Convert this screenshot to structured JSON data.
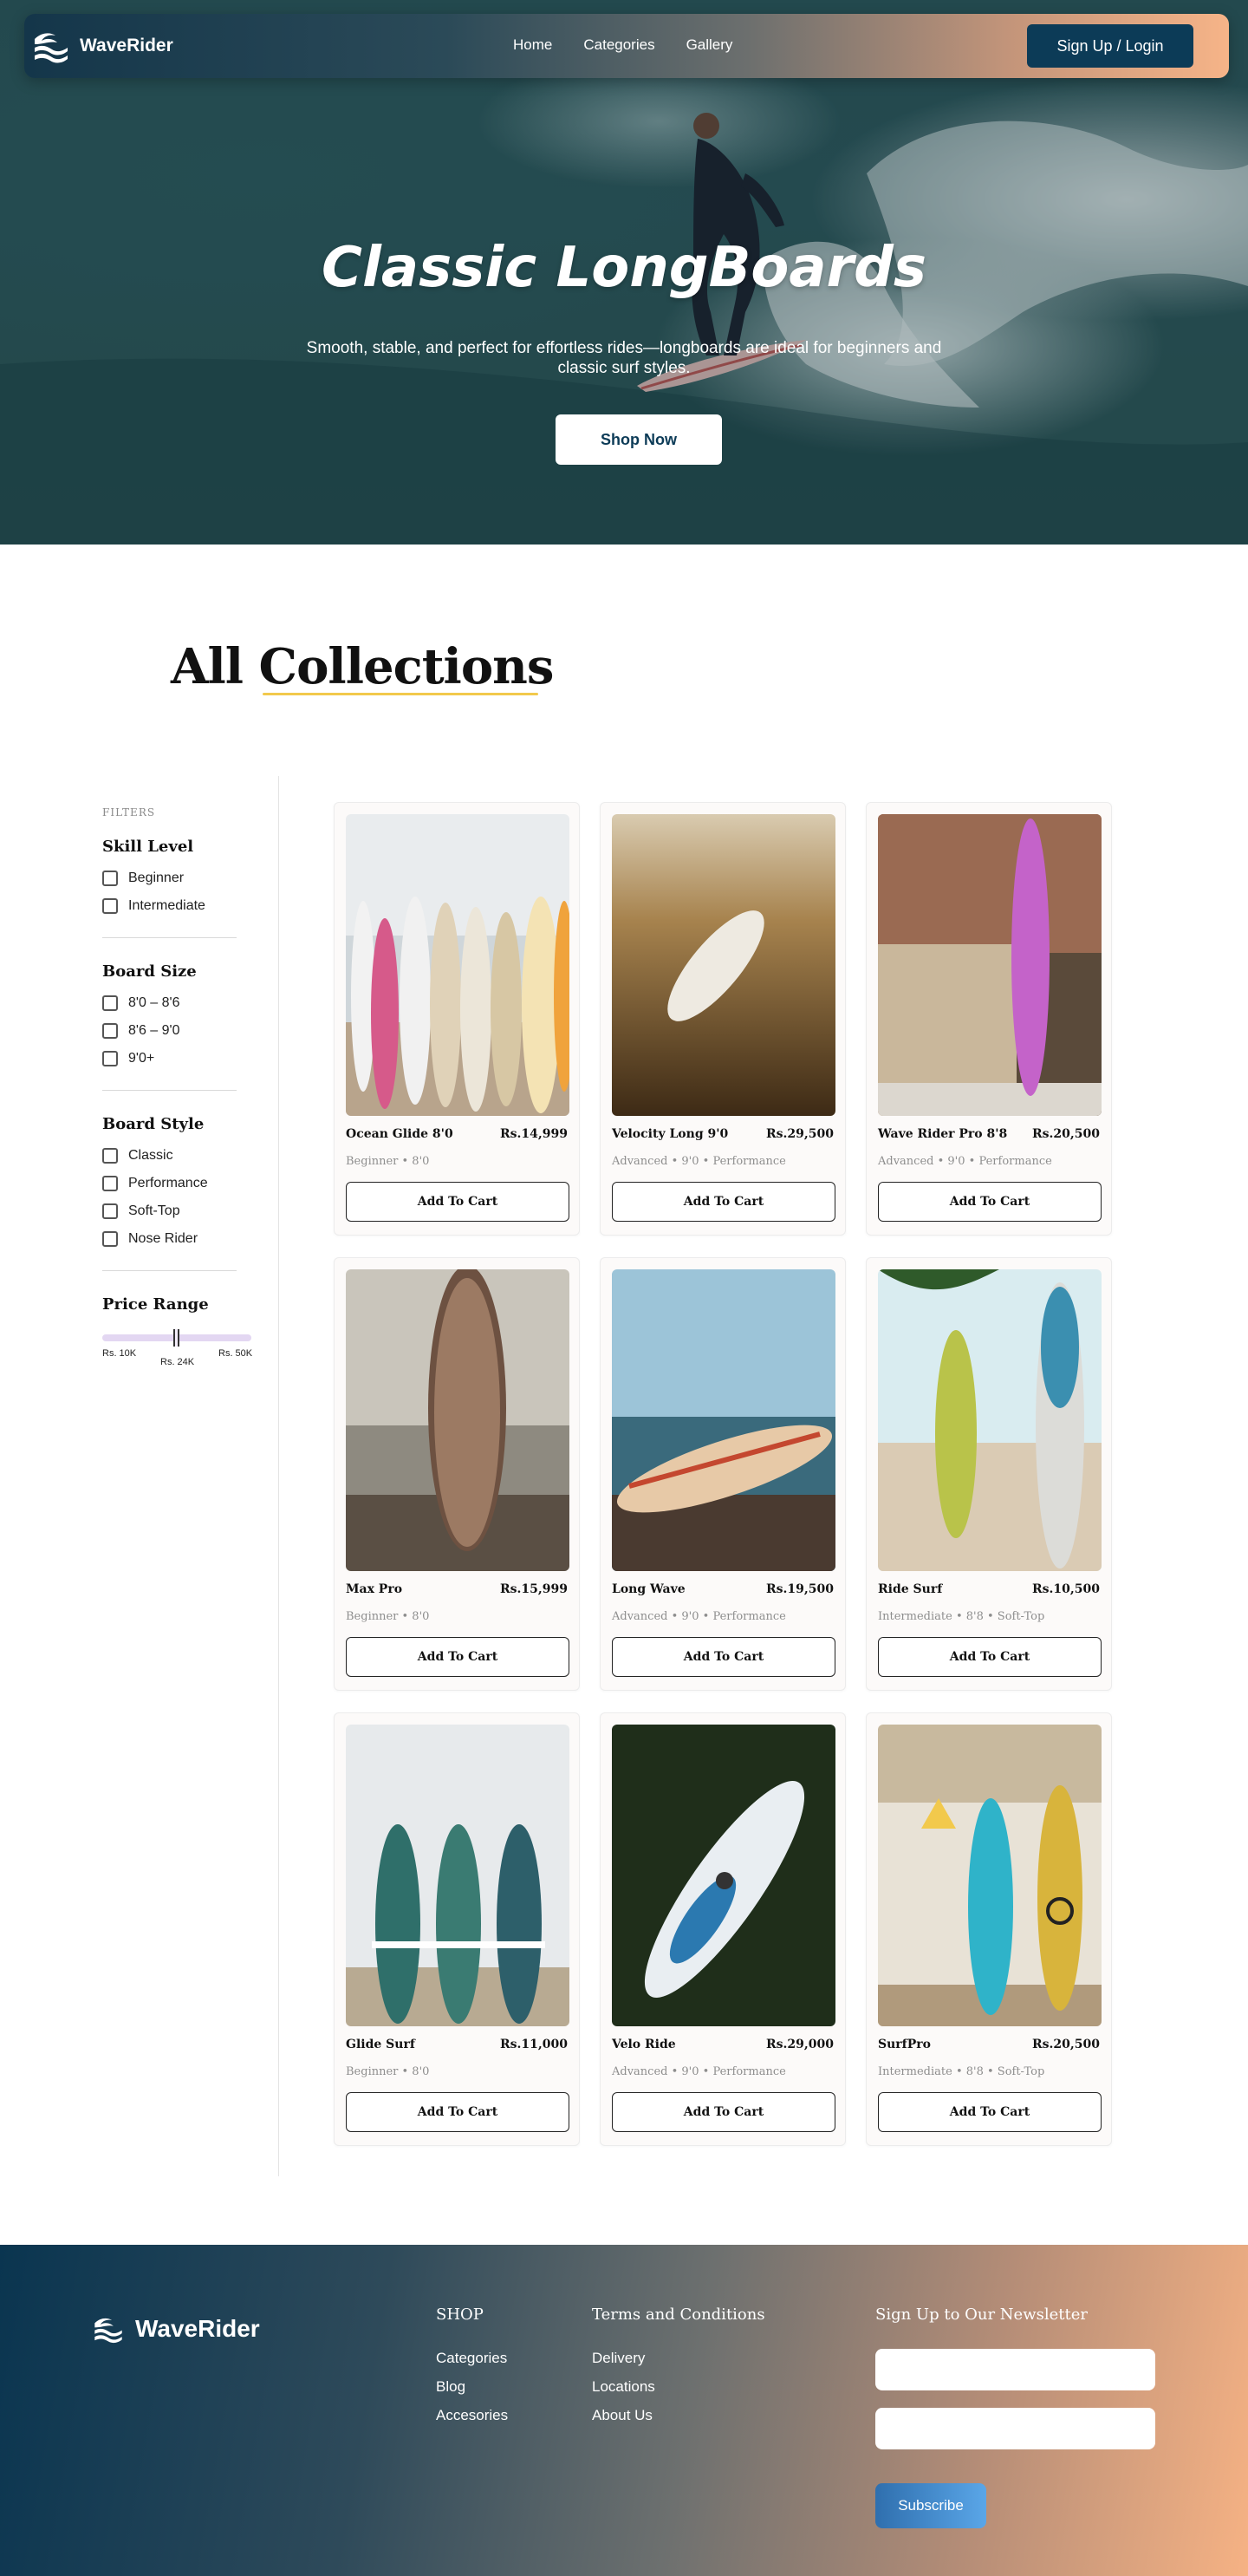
{
  "brand": {
    "name": "WaveRider"
  },
  "nav": {
    "links": [
      "Home",
      "Categories",
      "Gallery"
    ],
    "signup_label": "Sign Up / Login"
  },
  "hero": {
    "title": "Classic LongBoards",
    "subtitle": "Smooth, stable, and perfect for effortless rides—longboards are ideal for beginners and classic surf styles.",
    "cta_label": "Shop Now"
  },
  "collections": {
    "title": "All Collections"
  },
  "filters": {
    "label": "FILTERS",
    "skill_level": {
      "title": "Skill Level",
      "options": [
        "Beginner",
        "Intermediate"
      ]
    },
    "board_size": {
      "title": "Board Size",
      "options": [
        "8'0 – 8'6",
        "8'6 – 9'0",
        "9'0+"
      ]
    },
    "board_style": {
      "title": "Board Style",
      "options": [
        "Classic",
        "Performance",
        "Soft-Top",
        "Nose Rider"
      ]
    },
    "price_range": {
      "title": "Price Range",
      "min_label": "Rs. 10K",
      "max_label": "Rs. 50K",
      "value_label": "Rs. 24K",
      "min": 10000,
      "max": 50000,
      "value": 24000
    }
  },
  "products": [
    {
      "name": "Ocean Glide 8'0",
      "price": "Rs.14,999",
      "meta": "Beginner • 8'0",
      "cta": "Add To Cart"
    },
    {
      "name": "Velocity Long 9'0",
      "price": "Rs.29,500",
      "meta": "Advanced • 9'0 • Performance",
      "cta": "Add To Cart"
    },
    {
      "name": "Wave Rider Pro 8'8",
      "price": "Rs.20,500",
      "meta": "Advanced • 9'0 • Performance",
      "cta": "Add To Cart"
    },
    {
      "name": "Max Pro",
      "price": "Rs.15,999",
      "meta": "Beginner • 8'0",
      "cta": "Add To Cart"
    },
    {
      "name": "Long Wave",
      "price": "Rs.19,500",
      "meta": "Advanced • 9'0 • Performance",
      "cta": "Add To Cart"
    },
    {
      "name": "Ride Surf",
      "price": "Rs.10,500",
      "meta": "Intermediate • 8'8 • Soft-Top",
      "cta": "Add To Cart"
    },
    {
      "name": "Glide Surf",
      "price": "Rs.11,000",
      "meta": "Beginner • 8'0",
      "cta": "Add To Cart"
    },
    {
      "name": "Velo Ride",
      "price": "Rs.29,000",
      "meta": "Advanced • 9'0 • Performance",
      "cta": "Add To Cart"
    },
    {
      "name": "SurfPro",
      "price": "Rs.20,500",
      "meta": "Intermediate • 8'8 • Soft-Top",
      "cta": "Add To Cart"
    }
  ],
  "footer": {
    "shop": {
      "title": "SHOP",
      "links": [
        "Categories",
        "Blog",
        "Accesories"
      ]
    },
    "terms": {
      "title": "Terms and Conditions",
      "links": [
        "Delivery",
        "Locations",
        "About Us"
      ]
    },
    "newsletter": {
      "title": "Sign Up to Our Newsletter",
      "subscribe_label": "Subscribe"
    }
  },
  "colors": {
    "navy": "#0c3b57",
    "peach": "#f6b488",
    "accent_underline": "#f2c94c",
    "slider_track": "#e3d7f2"
  }
}
